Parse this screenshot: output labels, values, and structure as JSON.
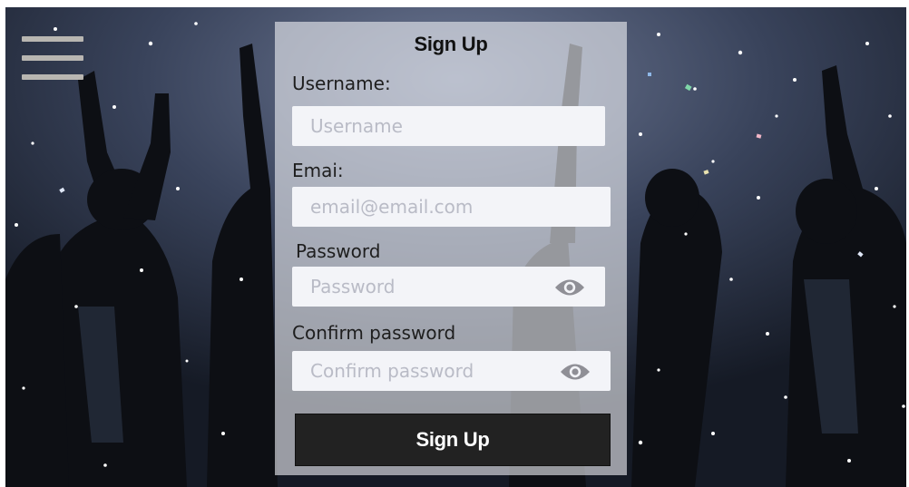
{
  "menu": {
    "icon": "hamburger-menu-icon"
  },
  "form": {
    "title": "Sign Up",
    "username": {
      "label": "Username:",
      "placeholder": "Username",
      "value": ""
    },
    "email": {
      "label": "Emai:",
      "placeholder": "email@email.com",
      "value": ""
    },
    "password": {
      "label": "Password",
      "placeholder": "Password",
      "value": "",
      "toggle_icon": "eye-icon"
    },
    "confirm_password": {
      "label": "Confirm password",
      "placeholder": "Confirm password",
      "value": "",
      "toggle_icon": "eye-icon"
    },
    "submit_label": "Sign Up"
  },
  "colors": {
    "panel": "#eceef2",
    "field": "#f3f4f8",
    "button": "#222222",
    "menu_bars": "#c8c4bc",
    "eye_icon": "#8f8f96"
  }
}
